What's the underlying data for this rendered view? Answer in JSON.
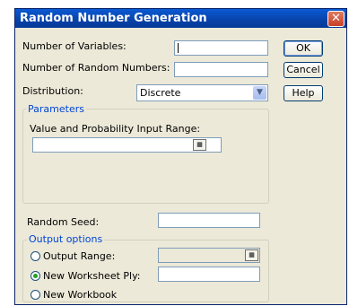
{
  "window": {
    "title": "Random Number Generation",
    "close_glyph": "✕"
  },
  "fields": {
    "num_variables_label": "Number of Variables:",
    "num_random_label": "Number of Random Numbers:",
    "distribution_label": "Distribution:",
    "distribution_value": "Discrete",
    "random_seed_label": "Random Seed:"
  },
  "buttons": {
    "ok": "OK",
    "cancel": "Cancel",
    "help": "Help"
  },
  "parameters": {
    "legend": "Parameters",
    "range_label": "Value and Probability Input Range:"
  },
  "output": {
    "legend": "Output options",
    "output_range_label": "Output Range:",
    "new_worksheet_label": "New Worksheet Ply:",
    "new_workbook_label": "New Workbook",
    "selected": "New Worksheet Ply"
  }
}
